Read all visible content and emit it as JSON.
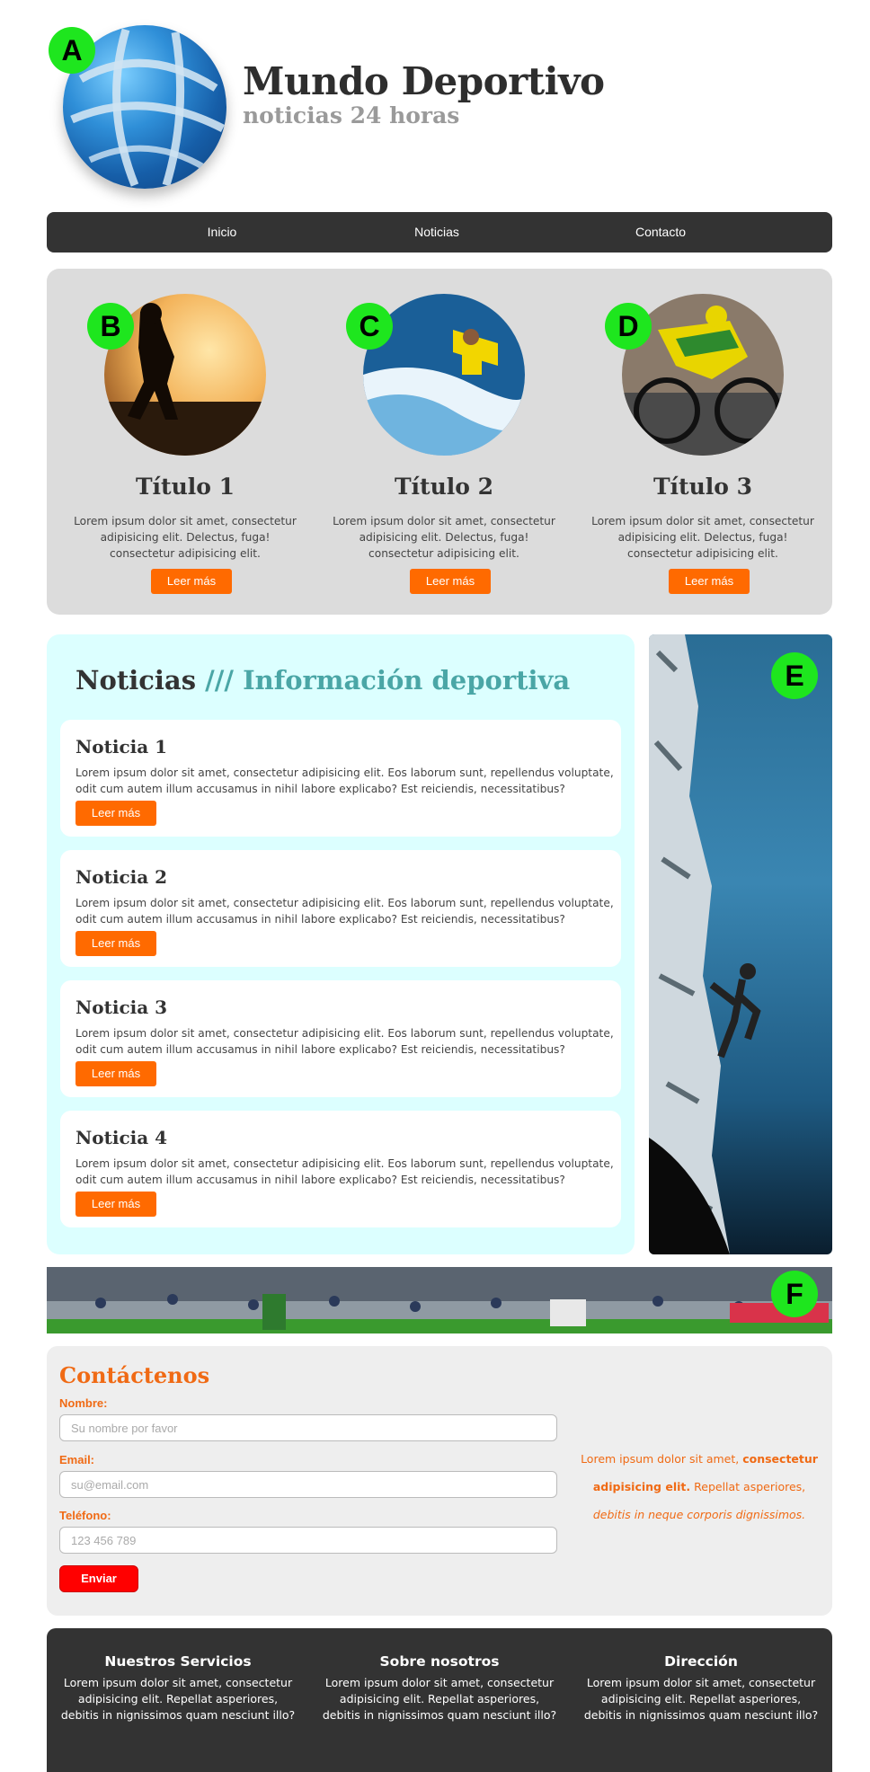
{
  "header": {
    "title": "Mundo Deportivo",
    "subtitle": "noticias 24 horas",
    "badge": "A"
  },
  "nav": {
    "items": [
      {
        "label": "Inicio"
      },
      {
        "label": "Noticias"
      },
      {
        "label": "Contacto"
      }
    ]
  },
  "features": [
    {
      "badge": "B",
      "title": "Título 1",
      "text": "Lorem ipsum dolor sit amet, consectetur adipisicing elit. Delectus, fuga! consectetur adipisicing elit.",
      "button": "Leer más"
    },
    {
      "badge": "C",
      "title": "Título 2",
      "text": "Lorem ipsum dolor sit amet, consectetur adipisicing elit. Delectus, fuga! consectetur adipisicing elit.",
      "button": "Leer más"
    },
    {
      "badge": "D",
      "title": "Título 3",
      "text": "Lorem ipsum dolor sit amet, consectetur adipisicing elit. Delectus, fuga! consectetur adipisicing elit.",
      "button": "Leer más"
    }
  ],
  "news": {
    "title_main": "Noticias",
    "title_sep": "///",
    "title_accent": "Información deportiva",
    "items": [
      {
        "title": "Noticia 1",
        "text": "Lorem ipsum dolor sit amet, consectetur adipisicing elit. Eos laborum sunt, repellendus voluptate, odit cum autem illum accusamus in nihil labore explicabo? Est reiciendis, necessitatibus?",
        "button": "Leer más"
      },
      {
        "title": "Noticia 2",
        "text": "Lorem ipsum dolor sit amet, consectetur adipisicing elit. Eos laborum sunt, repellendus voluptate, odit cum autem illum accusamus in nihil labore explicabo? Est reiciendis, necessitatibus?",
        "button": "Leer más"
      },
      {
        "title": "Noticia 3",
        "text": "Lorem ipsum dolor sit amet, consectetur adipisicing elit. Eos laborum sunt, repellendus voluptate, odit cum autem illum accusamus in nihil labore explicabo? Est reiciendis, necessitatibus?",
        "button": "Leer más"
      },
      {
        "title": "Noticia 4",
        "text": "Lorem ipsum dolor sit amet, consectetur adipisicing elit. Eos laborum sunt, repellendus voluptate, odit cum autem illum accusamus in nihil labore explicabo? Est reiciendis, necessitatibus?",
        "button": "Leer más"
      }
    ]
  },
  "side_image": {
    "badge": "E"
  },
  "banner": {
    "badge": "F"
  },
  "contact": {
    "title": "Contáctenos",
    "name_label": "Nombre:",
    "name_placeholder": "Su nombre por favor",
    "email_label": "Email:",
    "email_placeholder": "su@email.com",
    "phone_label": "Teléfono:",
    "phone_placeholder": "123 456 789",
    "send": "Enviar",
    "aside_a": "Lorem ipsum dolor sit amet,",
    "aside_b": "consectetur adipisicing elit.",
    "aside_c": "Repellat asperiores,",
    "aside_d": "debitis in neque corporis dignissimos."
  },
  "footer": [
    {
      "title": "Nuestros Servicios",
      "text": "Lorem ipsum dolor sit amet, consectetur adipisicing elit. Repellat asperiores, debitis in nignissimos quam nesciunt illo?"
    },
    {
      "title": "Sobre nosotros",
      "text": "Lorem ipsum dolor sit amet, consectetur adipisicing elit. Repellat asperiores, debitis in nignissimos quam nesciunt illo?"
    },
    {
      "title": "Dirección",
      "text": "Lorem ipsum dolor sit amet, consectetur adipisicing elit. Repellat asperiores, debitis in nignissimos quam nesciunt illo?"
    }
  ],
  "colors": {
    "accent_orange": "#ff6a00",
    "nav_dark": "#333333",
    "news_bg": "#dcffff",
    "badge_green": "#1ee61e",
    "send_red": "#ff0000"
  }
}
